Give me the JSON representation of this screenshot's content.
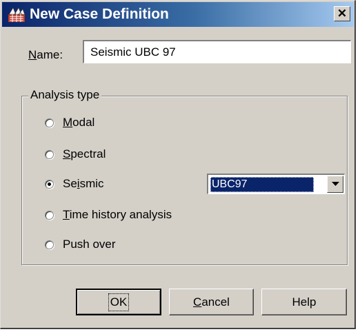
{
  "window": {
    "title": "New Case Definition",
    "close_symbol": "✕",
    "icon": "app-grid-icon"
  },
  "name_field": {
    "label_accel": "N",
    "label_rest": "ame:",
    "value": "Seismic UBC 97"
  },
  "analysis_group": {
    "legend": "Analysis type",
    "options": [
      {
        "pre": "",
        "accel": "M",
        "post": "odal",
        "checked": false
      },
      {
        "pre": "",
        "accel": "S",
        "post": "pectral",
        "checked": false
      },
      {
        "pre": "Se",
        "accel": "i",
        "post": "smic",
        "checked": true
      },
      {
        "pre": "",
        "accel": "T",
        "post": "ime history analysis",
        "checked": false
      },
      {
        "pre": "Push over",
        "accel": "",
        "post": "",
        "checked": false
      }
    ],
    "seismic_code": {
      "selected": "UBC97",
      "arrow_icon": "chevron-down-icon"
    }
  },
  "buttons": {
    "ok": "OK",
    "cancel_accel": "C",
    "cancel_rest": "ancel",
    "help": "Help"
  },
  "colors": {
    "title_bar": "#0a246a",
    "dialog_face": "#d4d0c8",
    "selection": "#0a246a"
  }
}
